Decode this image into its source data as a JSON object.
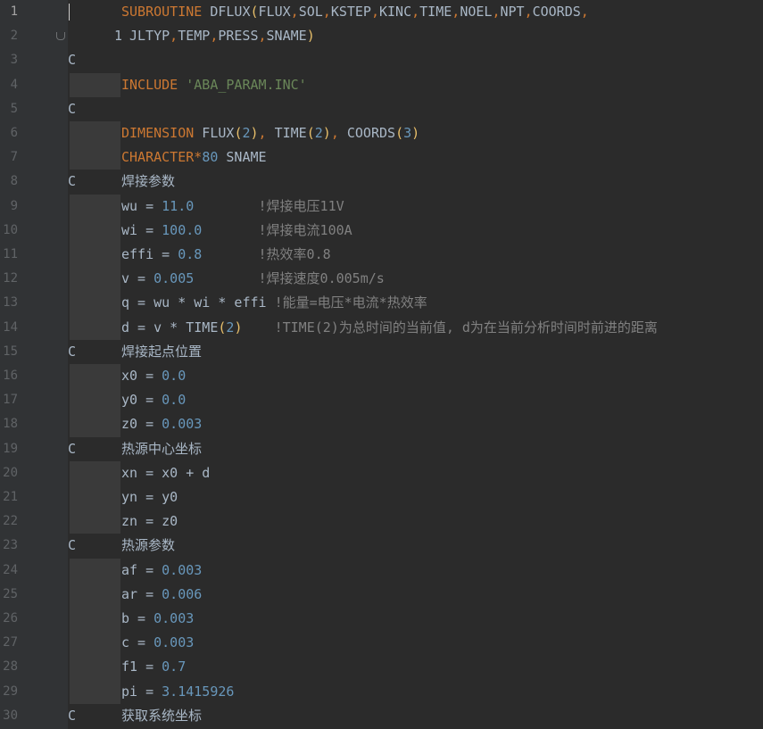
{
  "editor": {
    "lines": [
      {
        "n": "1",
        "code": [
          {
            "t": "kw",
            "v": "SUBROUTINE"
          },
          {
            "t": "plain",
            "v": " DFLUX"
          },
          {
            "t": "paren",
            "v": "("
          },
          {
            "t": "plain",
            "v": "FLUX"
          },
          {
            "t": "kw",
            "v": ","
          },
          {
            "t": "plain",
            "v": "SOL"
          },
          {
            "t": "kw",
            "v": ","
          },
          {
            "t": "plain",
            "v": "KSTEP"
          },
          {
            "t": "kw",
            "v": ","
          },
          {
            "t": "plain",
            "v": "KINC"
          },
          {
            "t": "kw",
            "v": ","
          },
          {
            "t": "plain",
            "v": "TIME"
          },
          {
            "t": "kw",
            "v": ","
          },
          {
            "t": "plain",
            "v": "NOEL"
          },
          {
            "t": "kw",
            "v": ","
          },
          {
            "t": "plain",
            "v": "NPT"
          },
          {
            "t": "kw",
            "v": ","
          },
          {
            "t": "plain",
            "v": "COORDS"
          },
          {
            "t": "kw",
            "v": ","
          }
        ]
      },
      {
        "n": "2",
        "cont": "1",
        "code": [
          {
            "t": "plain",
            "v": "JLTYP"
          },
          {
            "t": "kw",
            "v": ","
          },
          {
            "t": "plain",
            "v": "TEMP"
          },
          {
            "t": "kw",
            "v": ","
          },
          {
            "t": "plain",
            "v": "PRESS"
          },
          {
            "t": "kw",
            "v": ","
          },
          {
            "t": "plain",
            "v": "SNAME"
          },
          {
            "t": "paren",
            "v": ")"
          }
        ]
      },
      {
        "n": "3",
        "c": "C",
        "code": []
      },
      {
        "n": "4",
        "code": [
          {
            "t": "kw",
            "v": "INCLUDE"
          },
          {
            "t": "plain",
            "v": " "
          },
          {
            "t": "str",
            "v": "'ABA_PARAM.INC'"
          }
        ]
      },
      {
        "n": "5",
        "c": "C",
        "code": []
      },
      {
        "n": "6",
        "code": [
          {
            "t": "kw",
            "v": "DIMENSION"
          },
          {
            "t": "plain",
            "v": " FLUX"
          },
          {
            "t": "paren",
            "v": "("
          },
          {
            "t": "num",
            "v": "2"
          },
          {
            "t": "paren",
            "v": ")"
          },
          {
            "t": "kw",
            "v": ","
          },
          {
            "t": "plain",
            "v": " TIME"
          },
          {
            "t": "paren",
            "v": "("
          },
          {
            "t": "num",
            "v": "2"
          },
          {
            "t": "paren",
            "v": ")"
          },
          {
            "t": "kw",
            "v": ","
          },
          {
            "t": "plain",
            "v": " COORDS"
          },
          {
            "t": "paren",
            "v": "("
          },
          {
            "t": "num",
            "v": "3"
          },
          {
            "t": "paren",
            "v": ")"
          }
        ]
      },
      {
        "n": "7",
        "code": [
          {
            "t": "kw",
            "v": "CHARACTER*"
          },
          {
            "t": "num",
            "v": "80"
          },
          {
            "t": "plain",
            "v": " SNAME"
          }
        ]
      },
      {
        "n": "8",
        "c": "C",
        "code": [
          {
            "t": "cmt",
            "v": "焊接参数"
          }
        ]
      },
      {
        "n": "9",
        "code": [
          {
            "t": "plain",
            "v": "wu = "
          },
          {
            "t": "num",
            "v": "11.0"
          },
          {
            "t": "cm",
            "v": "        !焊接电压11V"
          }
        ]
      },
      {
        "n": "10",
        "code": [
          {
            "t": "plain",
            "v": "wi = "
          },
          {
            "t": "num",
            "v": "100.0"
          },
          {
            "t": "cm",
            "v": "       !焊接电流100A"
          }
        ]
      },
      {
        "n": "11",
        "code": [
          {
            "t": "plain",
            "v": "effi = "
          },
          {
            "t": "num",
            "v": "0.8"
          },
          {
            "t": "cm",
            "v": "       !热效率0.8"
          }
        ]
      },
      {
        "n": "12",
        "code": [
          {
            "t": "plain",
            "v": "v = "
          },
          {
            "t": "num",
            "v": "0.005"
          },
          {
            "t": "cm",
            "v": "        !焊接速度0.005m/s"
          }
        ]
      },
      {
        "n": "13",
        "code": [
          {
            "t": "plain",
            "v": "q = wu * wi * effi "
          },
          {
            "t": "cm",
            "v": "!能量=电压*电流*热效率"
          }
        ]
      },
      {
        "n": "14",
        "code": [
          {
            "t": "plain",
            "v": "d = v * TIME"
          },
          {
            "t": "paren",
            "v": "("
          },
          {
            "t": "num",
            "v": "2"
          },
          {
            "t": "paren",
            "v": ")"
          },
          {
            "t": "cm",
            "v": "    !TIME(2)为总时间的当前值, d为在当前分析时间时前进的距离"
          }
        ]
      },
      {
        "n": "15",
        "c": "C",
        "code": [
          {
            "t": "cmt",
            "v": "焊接起点位置"
          }
        ]
      },
      {
        "n": "16",
        "code": [
          {
            "t": "plain",
            "v": "x0 = "
          },
          {
            "t": "num",
            "v": "0.0"
          }
        ]
      },
      {
        "n": "17",
        "code": [
          {
            "t": "plain",
            "v": "y0 = "
          },
          {
            "t": "num",
            "v": "0.0"
          }
        ]
      },
      {
        "n": "18",
        "code": [
          {
            "t": "plain",
            "v": "z0 = "
          },
          {
            "t": "num",
            "v": "0.003"
          }
        ]
      },
      {
        "n": "19",
        "c": "C",
        "code": [
          {
            "t": "cmt",
            "v": "热源中心坐标"
          }
        ]
      },
      {
        "n": "20",
        "code": [
          {
            "t": "plain",
            "v": "xn = x0 + d"
          }
        ]
      },
      {
        "n": "21",
        "code": [
          {
            "t": "plain",
            "v": "yn = y0"
          }
        ]
      },
      {
        "n": "22",
        "code": [
          {
            "t": "plain",
            "v": "zn = z0"
          }
        ]
      },
      {
        "n": "23",
        "c": "C",
        "code": [
          {
            "t": "cmt",
            "v": "热源参数"
          }
        ]
      },
      {
        "n": "24",
        "code": [
          {
            "t": "plain",
            "v": "af = "
          },
          {
            "t": "num",
            "v": "0.003"
          }
        ]
      },
      {
        "n": "25",
        "code": [
          {
            "t": "plain",
            "v": "ar = "
          },
          {
            "t": "num",
            "v": "0.006"
          }
        ]
      },
      {
        "n": "26",
        "code": [
          {
            "t": "plain",
            "v": "b = "
          },
          {
            "t": "num",
            "v": "0.003"
          }
        ]
      },
      {
        "n": "27",
        "code": [
          {
            "t": "plain",
            "v": "c = "
          },
          {
            "t": "num",
            "v": "0.003"
          }
        ]
      },
      {
        "n": "28",
        "code": [
          {
            "t": "plain",
            "v": "f1 = "
          },
          {
            "t": "num",
            "v": "0.7"
          }
        ]
      },
      {
        "n": "29",
        "code": [
          {
            "t": "plain",
            "v": "pi = "
          },
          {
            "t": "num",
            "v": "3.1415926"
          }
        ]
      },
      {
        "n": "30",
        "c": "C",
        "code": [
          {
            "t": "cmt",
            "v": "获取系统坐标"
          }
        ]
      }
    ]
  }
}
